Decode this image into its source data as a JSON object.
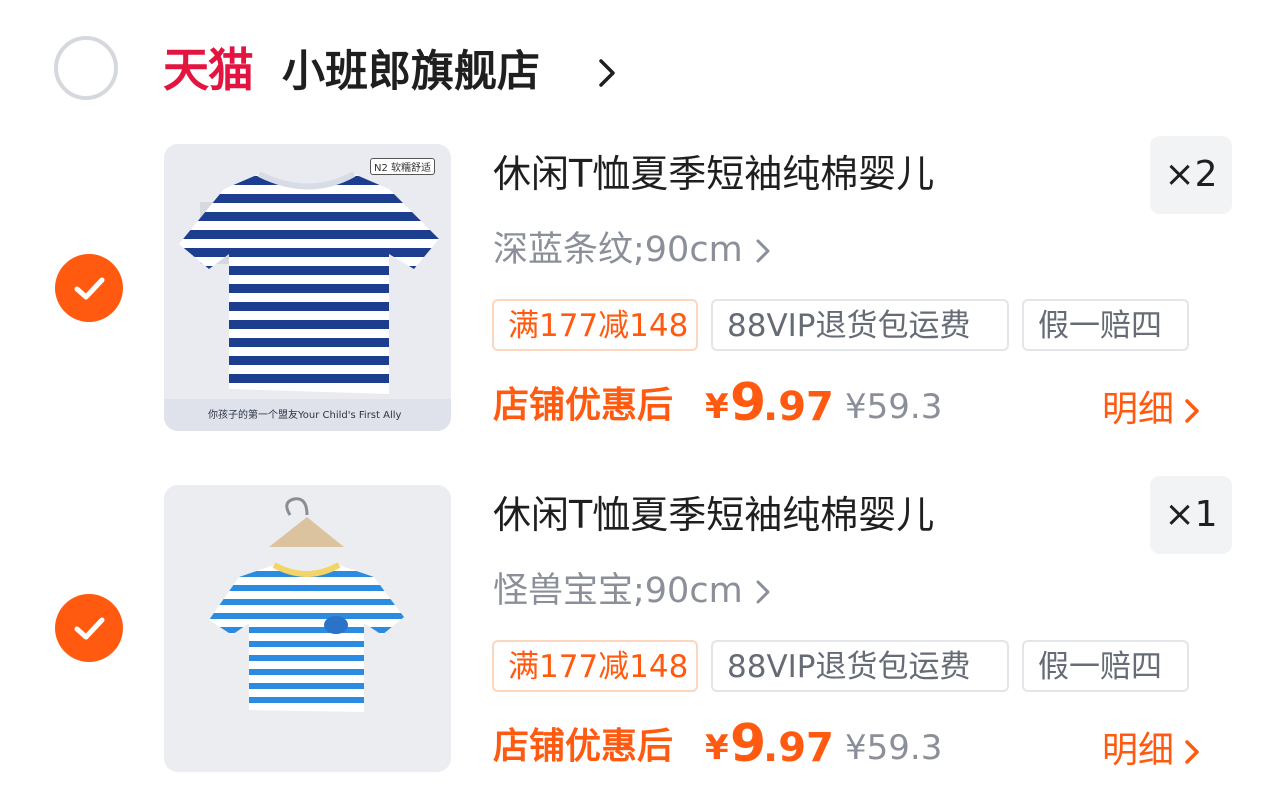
{
  "store": {
    "platform": "天猫",
    "name": "小班郎旗舰店"
  },
  "items": [
    {
      "title": "休闲T恤夏季短袖纯棉婴儿",
      "spec": "深蓝条纹;90cm",
      "quantity": "×2",
      "tags": [
        "满177减148",
        "88VIP退货包运费",
        "假一赔四"
      ],
      "price_label": "店铺优惠后",
      "currency": "¥",
      "price_int": "9",
      "price_dec": ".97",
      "original_price": "¥59.3",
      "detail": "明细",
      "image": {
        "badge": "N2 软糯舒适",
        "caption": "你孩子的第一个盟友Your Child's First Ally",
        "stripe_color": "#1d3d8f"
      }
    },
    {
      "title": "休闲T恤夏季短袖纯棉婴儿",
      "spec": "怪兽宝宝;90cm",
      "quantity": "×1",
      "tags": [
        "满177减148",
        "88VIP退货包运费",
        "假一赔四"
      ],
      "price_label": "店铺优惠后",
      "currency": "¥",
      "price_int": "9",
      "price_dec": ".97",
      "original_price": "¥59.3",
      "detail": "明细",
      "image": {
        "stripe_color": "#2b8be0"
      }
    }
  ],
  "colors": {
    "accent": "#ff5a0f",
    "tmall": "#e3143f",
    "muted": "#8a8f99"
  }
}
